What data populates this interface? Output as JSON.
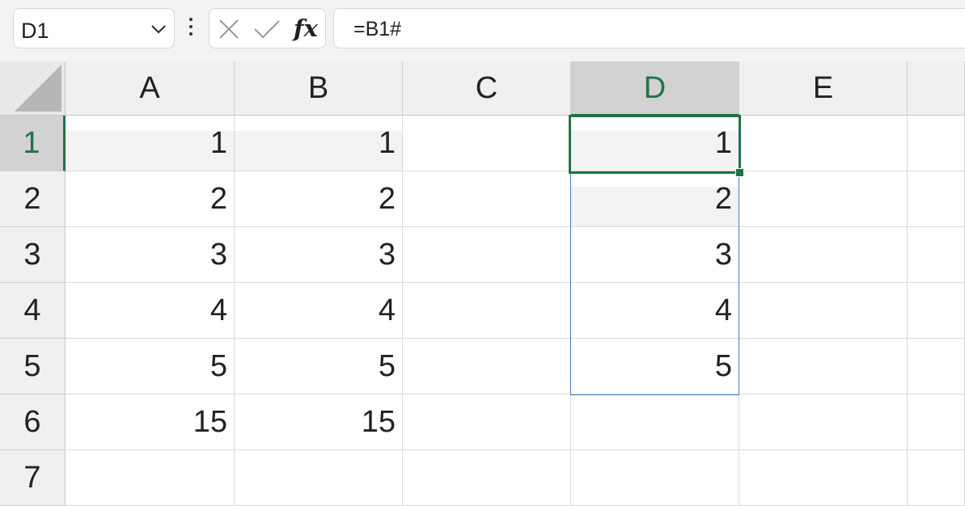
{
  "name_box": {
    "value": "D1"
  },
  "formula_bar": {
    "cancel_icon": "x-icon",
    "enter_icon": "check-icon",
    "fx_label": "fx",
    "formula": "=B1#"
  },
  "columns": [
    "A",
    "B",
    "C",
    "D",
    "E"
  ],
  "selected_column": "D",
  "rows": [
    "1",
    "2",
    "3",
    "4",
    "5",
    "6",
    "7"
  ],
  "selected_row": "1",
  "cells": {
    "A": [
      "1",
      "2",
      "3",
      "4",
      "5",
      "15",
      ""
    ],
    "B": [
      "1",
      "2",
      "3",
      "4",
      "5",
      "15",
      ""
    ],
    "C": [
      "",
      "",
      "",
      "",
      "",
      "",
      ""
    ],
    "D": [
      "1",
      "2",
      "3",
      "4",
      "5",
      "",
      ""
    ],
    "E": [
      "",
      "",
      "",
      "",
      "",
      "",
      ""
    ]
  },
  "colors": {
    "accent": "#217346",
    "spill_border": "#4a7ac4"
  }
}
